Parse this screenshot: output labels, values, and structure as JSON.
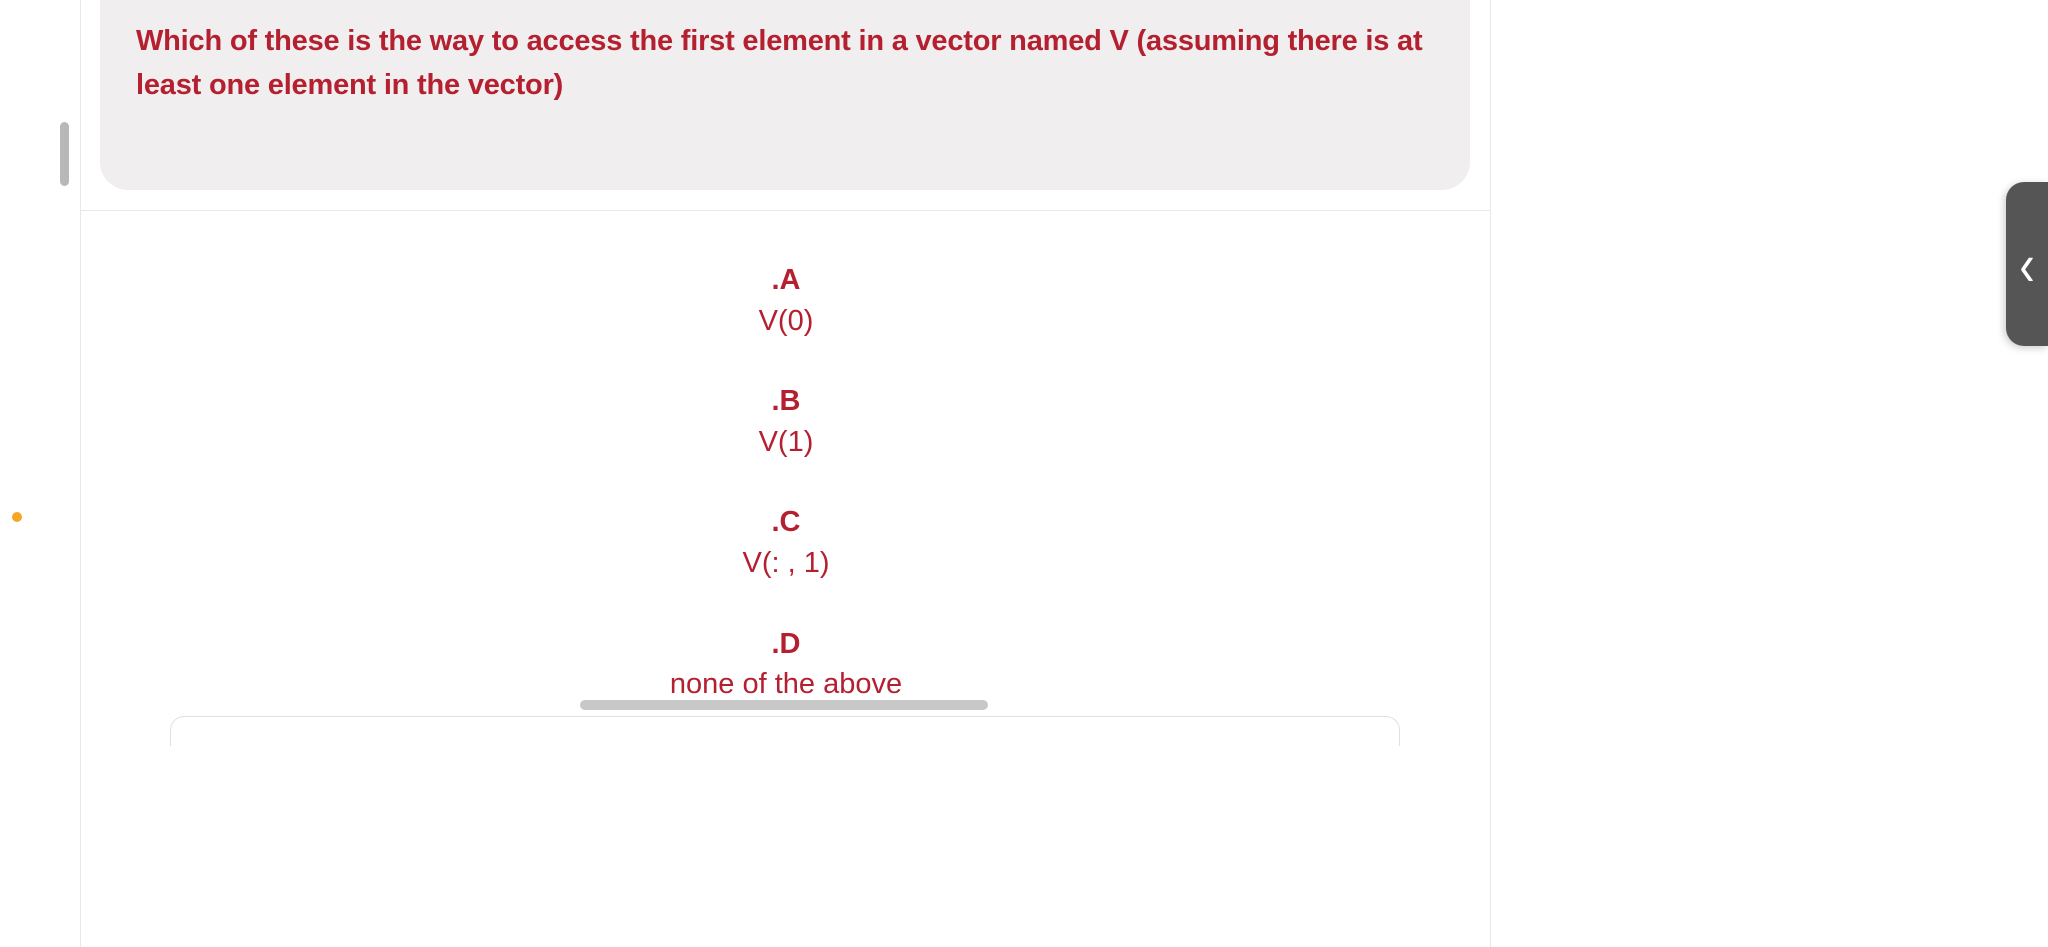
{
  "question": {
    "text": "Which of these is the way to access the first element in a vector named V (assuming there is at least one element in the vector)"
  },
  "answers": {
    "options": [
      {
        "label": ".A",
        "text": "V(0)"
      },
      {
        "label": ".B",
        "text": "V(1)"
      },
      {
        "label": ".C",
        "text": "V(: , 1)"
      },
      {
        "label": ".D",
        "text": "none of the above"
      }
    ]
  },
  "colors": {
    "primary": "#b42030",
    "cardBg": "#f0eeee",
    "accent": "#f5a623"
  }
}
